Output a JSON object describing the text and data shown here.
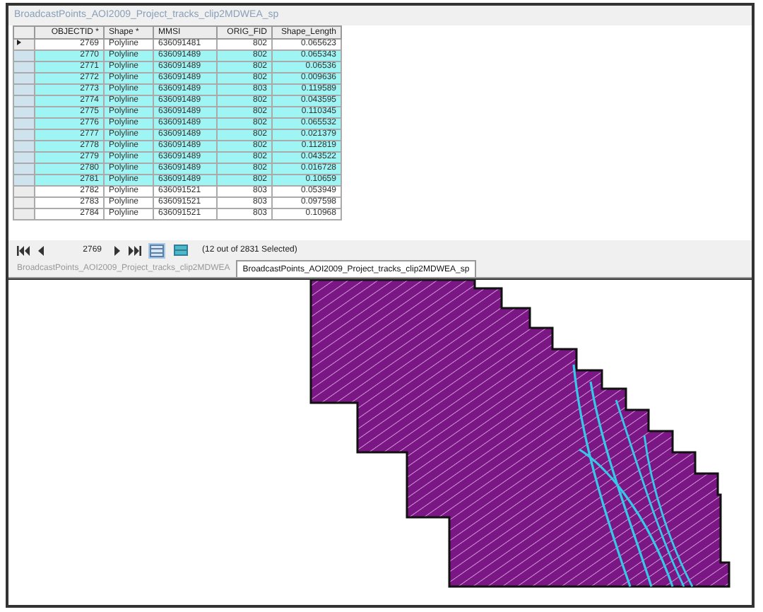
{
  "window": {
    "title": "BroadcastPoints_AOI2009_Project_tracks_clip2MDWEA_sp"
  },
  "table": {
    "columns": [
      "OBJECTID *",
      "Shape *",
      "MMSI",
      "ORIG_FID",
      "Shape_Length"
    ],
    "rows": [
      {
        "cells": [
          "2769",
          "Polyline",
          "636091481",
          "802",
          "0.065623"
        ],
        "selected": false,
        "current": true
      },
      {
        "cells": [
          "2770",
          "Polyline",
          "636091489",
          "802",
          "0.065343"
        ],
        "selected": true,
        "current": false
      },
      {
        "cells": [
          "2771",
          "Polyline",
          "636091489",
          "802",
          "0.06536"
        ],
        "selected": true,
        "current": false
      },
      {
        "cells": [
          "2772",
          "Polyline",
          "636091489",
          "802",
          "0.009636"
        ],
        "selected": true,
        "current": false
      },
      {
        "cells": [
          "2773",
          "Polyline",
          "636091489",
          "803",
          "0.119589"
        ],
        "selected": true,
        "current": false
      },
      {
        "cells": [
          "2774",
          "Polyline",
          "636091489",
          "802",
          "0.043595"
        ],
        "selected": true,
        "current": false
      },
      {
        "cells": [
          "2775",
          "Polyline",
          "636091489",
          "802",
          "0.110345"
        ],
        "selected": true,
        "current": false
      },
      {
        "cells": [
          "2776",
          "Polyline",
          "636091489",
          "802",
          "0.065532"
        ],
        "selected": true,
        "current": false
      },
      {
        "cells": [
          "2777",
          "Polyline",
          "636091489",
          "802",
          "0.021379"
        ],
        "selected": true,
        "current": false
      },
      {
        "cells": [
          "2778",
          "Polyline",
          "636091489",
          "802",
          "0.112819"
        ],
        "selected": true,
        "current": false
      },
      {
        "cells": [
          "2779",
          "Polyline",
          "636091489",
          "802",
          "0.043522"
        ],
        "selected": true,
        "current": false
      },
      {
        "cells": [
          "2780",
          "Polyline",
          "636091489",
          "802",
          "0.016728"
        ],
        "selected": true,
        "current": false
      },
      {
        "cells": [
          "2781",
          "Polyline",
          "636091489",
          "802",
          "0.10659"
        ],
        "selected": true,
        "current": false
      },
      {
        "cells": [
          "2782",
          "Polyline",
          "636091521",
          "803",
          "0.053949"
        ],
        "selected": false,
        "current": false
      },
      {
        "cells": [
          "2783",
          "Polyline",
          "636091521",
          "803",
          "0.097598"
        ],
        "selected": false,
        "current": false
      },
      {
        "cells": [
          "2784",
          "Polyline",
          "636091521",
          "803",
          "0.10968"
        ],
        "selected": false,
        "current": false
      }
    ]
  },
  "navigator": {
    "record": "2769",
    "status": "(12 out of 2831 Selected)"
  },
  "tabs": [
    {
      "label": "BroadcastPoints_AOI2009_Project_tracks_clip2MDWEA",
      "selected": false
    },
    {
      "label": "BroadcastPoints_AOI2009_Project_tracks_clip2MDWEA_sp",
      "selected": true
    }
  ]
}
